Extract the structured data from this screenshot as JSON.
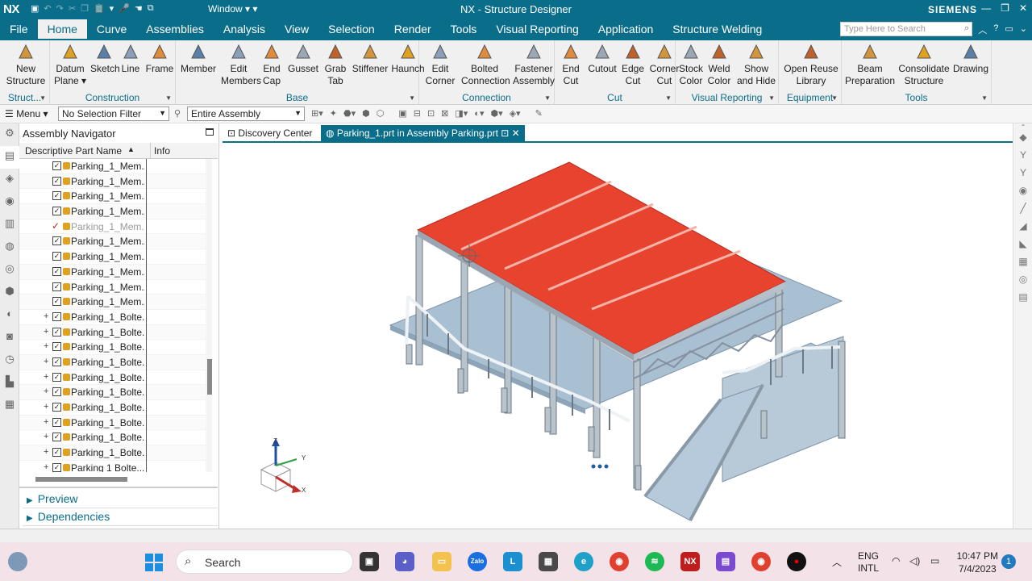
{
  "titlebar": {
    "logo": "NX",
    "window_menu": "Window",
    "title": "NX - Structure Designer",
    "brand": "SIEMENS"
  },
  "menubar": {
    "file": "File",
    "tabs": [
      "Home",
      "Curve",
      "Assemblies",
      "Analysis",
      "View",
      "Selection",
      "Render",
      "Tools",
      "Visual Reporting",
      "Application",
      "Structure Welding"
    ],
    "active_tab": "Home",
    "search_placeholder": "Type Here to Search"
  },
  "ribbon": {
    "groups": [
      {
        "label": "Struct...",
        "buttons": [
          {
            "line1": "New",
            "line2": "Structure",
            "icon": "new-structure-icon"
          }
        ]
      },
      {
        "label": "Construction",
        "buttons": [
          {
            "line1": "Datum",
            "line2": "Plane ▾",
            "icon": "datum-plane-icon"
          },
          {
            "line1": "Sketch",
            "line2": "",
            "icon": "sketch-icon"
          },
          {
            "line1": "Line",
            "line2": "",
            "icon": "line-icon"
          },
          {
            "line1": "Frame",
            "line2": "",
            "icon": "frame-icon"
          }
        ]
      },
      {
        "label": "Base",
        "buttons": [
          {
            "line1": "Member",
            "line2": "",
            "icon": "member-icon"
          },
          {
            "line1": "Edit",
            "line2": "Members",
            "icon": "edit-members-icon"
          },
          {
            "line1": "End",
            "line2": "Cap",
            "icon": "end-cap-icon"
          },
          {
            "line1": "Gusset",
            "line2": "",
            "icon": "gusset-icon"
          },
          {
            "line1": "Grab",
            "line2": "Tab",
            "icon": "grab-tab-icon"
          },
          {
            "line1": "Stiffener",
            "line2": "",
            "icon": "stiffener-icon"
          },
          {
            "line1": "Haunch",
            "line2": "",
            "icon": "haunch-icon"
          }
        ]
      },
      {
        "label": "Connection",
        "buttons": [
          {
            "line1": "Edit",
            "line2": "Corner",
            "icon": "edit-corner-icon"
          },
          {
            "line1": "Bolted",
            "line2": "Connection",
            "icon": "bolted-connection-icon"
          },
          {
            "line1": "Fastener",
            "line2": "Assembly",
            "icon": "fastener-assembly-icon"
          }
        ]
      },
      {
        "label": "Cut",
        "buttons": [
          {
            "line1": "End",
            "line2": "Cut",
            "icon": "end-cut-icon"
          },
          {
            "line1": "Cutout",
            "line2": "",
            "icon": "cutout-icon"
          },
          {
            "line1": "Edge",
            "line2": "Cut",
            "icon": "edge-cut-icon"
          },
          {
            "line1": "Corner",
            "line2": "Cut",
            "icon": "corner-cut-icon"
          }
        ]
      },
      {
        "label": "Visual Reporting",
        "buttons": [
          {
            "line1": "Stock",
            "line2": "Color",
            "icon": "stock-color-icon"
          },
          {
            "line1": "Weld",
            "line2": "Color",
            "icon": "weld-color-icon"
          },
          {
            "line1": "Show",
            "line2": "and Hide",
            "icon": "show-hide-icon"
          }
        ]
      },
      {
        "label": "Equipment",
        "buttons": [
          {
            "line1": "Open Reuse",
            "line2": "Library",
            "icon": "reuse-library-icon"
          }
        ]
      },
      {
        "label": "Tools",
        "buttons": [
          {
            "line1": "Beam",
            "line2": "Preparation",
            "icon": "beam-preparation-icon"
          },
          {
            "line1": "Consolidate",
            "line2": "Structure",
            "icon": "consolidate-structure-icon"
          },
          {
            "line1": "Drawing",
            "line2": "",
            "icon": "drawing-icon"
          }
        ]
      }
    ]
  },
  "toolbar": {
    "menu": "Menu",
    "selection_filter": "No Selection Filter",
    "scope": "Entire Assembly"
  },
  "navigator": {
    "title": "Assembly Navigator",
    "col_name": "Descriptive Part Name",
    "col_info": "Info",
    "rows": [
      {
        "name": "Parking_1_Mem...",
        "expand": "",
        "state": "checked"
      },
      {
        "name": "Parking_1_Mem...",
        "expand": "",
        "state": "checked"
      },
      {
        "name": "Parking_1_Mem...",
        "expand": "",
        "state": "checked"
      },
      {
        "name": "Parking_1_Mem...",
        "expand": "",
        "state": "checked"
      },
      {
        "name": "Parking_1_Mem...",
        "expand": "",
        "state": "tick"
      },
      {
        "name": "Parking_1_Mem...",
        "expand": "",
        "state": "checked"
      },
      {
        "name": "Parking_1_Mem...",
        "expand": "",
        "state": "checked"
      },
      {
        "name": "Parking_1_Mem...",
        "expand": "",
        "state": "checked"
      },
      {
        "name": "Parking_1_Mem...",
        "expand": "",
        "state": "checked"
      },
      {
        "name": "Parking_1_Mem...",
        "expand": "",
        "state": "checked"
      },
      {
        "name": "Parking_1_Bolte...",
        "expand": "+",
        "state": "checked"
      },
      {
        "name": "Parking_1_Bolte...",
        "expand": "+",
        "state": "checked"
      },
      {
        "name": "Parking_1_Bolte...",
        "expand": "+",
        "state": "checked"
      },
      {
        "name": "Parking_1_Bolte...",
        "expand": "+",
        "state": "checked"
      },
      {
        "name": "Parking_1_Bolte...",
        "expand": "+",
        "state": "checked"
      },
      {
        "name": "Parking_1_Bolte...",
        "expand": "+",
        "state": "checked"
      },
      {
        "name": "Parking_1_Bolte...",
        "expand": "+",
        "state": "checked"
      },
      {
        "name": "Parking_1_Bolte...",
        "expand": "+",
        "state": "checked"
      },
      {
        "name": "Parking_1_Bolte...",
        "expand": "+",
        "state": "checked"
      },
      {
        "name": "Parking_1_Bolte...",
        "expand": "+",
        "state": "checked"
      },
      {
        "name": "Parking 1 Bolte...",
        "expand": "+",
        "state": "checked"
      }
    ],
    "preview": "Preview",
    "dependencies": "Dependencies"
  },
  "doc_tabs": {
    "discovery": "Discovery Center",
    "active": "Parking_1.prt in Assembly Parking.prt"
  },
  "viewport": {
    "triad": {
      "z": "Z",
      "y": "Y",
      "x": "X"
    },
    "colors": {
      "roof": "#e8432e",
      "steel": "#b9c3cc",
      "deck": "#a9bfd2"
    }
  },
  "taskbar": {
    "search": "Search",
    "lang1": "ENG",
    "lang2": "INTL",
    "time": "10:47 PM",
    "date": "7/4/2023",
    "notifications": "1",
    "apps": [
      "file-explorer",
      "zalo",
      "l-app",
      "store",
      "edge",
      "chrome",
      "spotify",
      "nx",
      "film",
      "chrome-2",
      "recorder"
    ]
  }
}
